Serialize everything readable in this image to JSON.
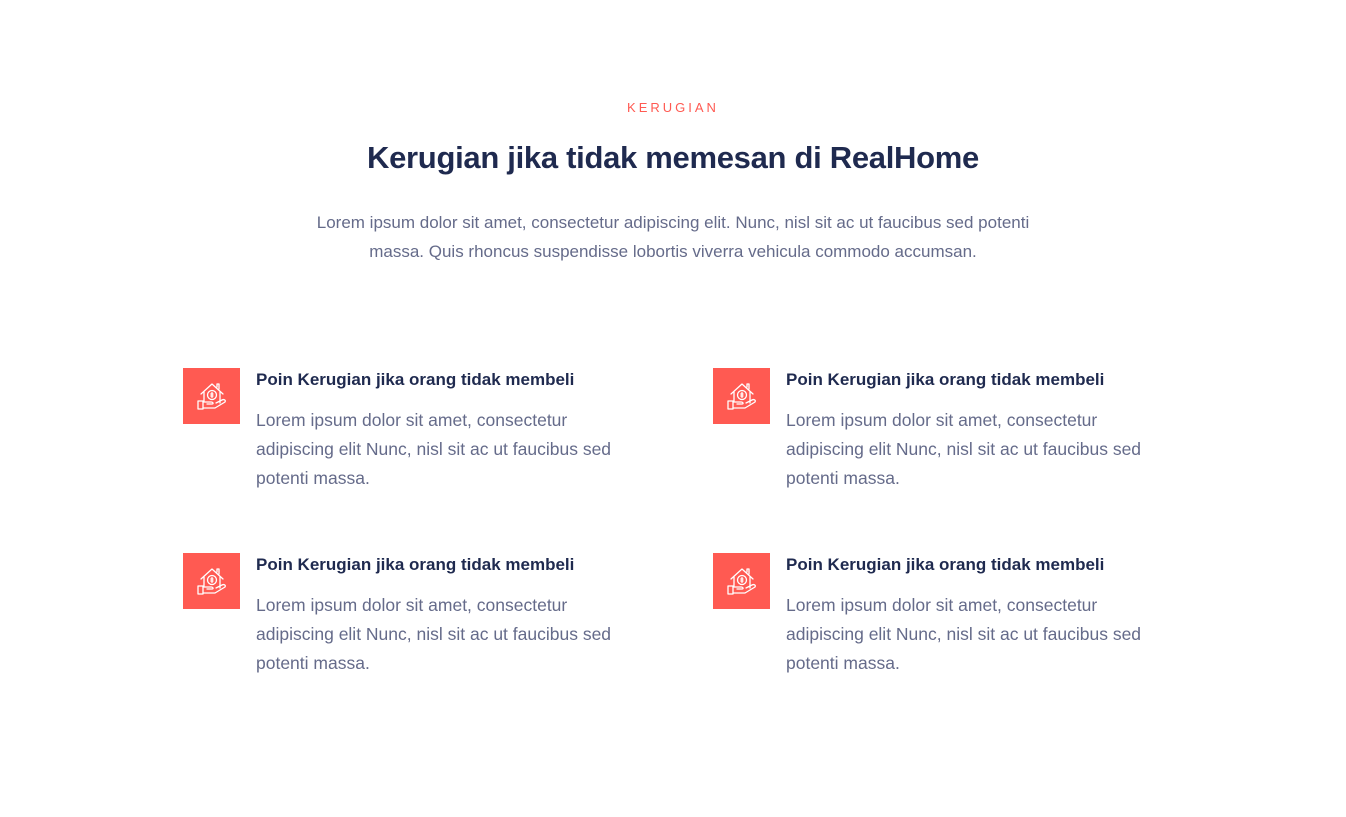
{
  "section": {
    "eyebrow": "KERUGIAN",
    "title": "Kerugian jika tidak memesan di RealHome",
    "subtitle_lines": [
      "Lorem ipsum dolor sit amet, consectetur adipiscing elit. Nunc, nisl sit ac ut faucibus sed potenti",
      "massa. Quis rhoncus suspendisse lobortis viverra vehicula commodo accumsan."
    ],
    "accent_color": "#ff5a52",
    "heading_color": "#1f2a4f"
  },
  "items": [
    {
      "icon": "house-money-hand-icon",
      "title": "Poin Kerugian jika orang tidak membeli",
      "body": "Lorem ipsum dolor sit amet, consectetur adipiscing elit Nunc, nisl sit ac ut faucibus sed potenti massa."
    },
    {
      "icon": "house-money-hand-icon",
      "title": "Poin Kerugian jika orang tidak membeli",
      "body": "Lorem ipsum dolor sit amet, consectetur adipiscing elit Nunc, nisl sit ac ut faucibus sed potenti massa."
    },
    {
      "icon": "house-money-hand-icon",
      "title": "Poin Kerugian jika orang tidak membeli",
      "body": "Lorem ipsum dolor sit amet, consectetur adipiscing elit Nunc, nisl sit ac ut faucibus sed potenti massa."
    },
    {
      "icon": "house-money-hand-icon",
      "title": "Poin Kerugian jika orang tidak membeli",
      "body": "Lorem ipsum dolor sit amet, consectetur adipiscing elit Nunc, nisl sit ac ut faucibus sed potenti massa."
    }
  ]
}
